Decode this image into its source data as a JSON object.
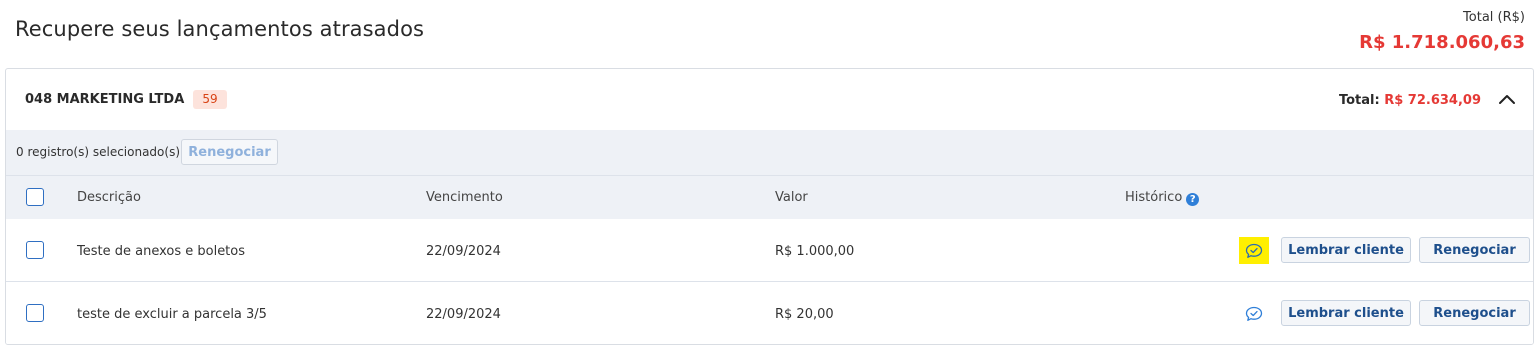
{
  "page": {
    "title": "Recupere seus lançamentos atrasados",
    "total_label": "Total (R$)",
    "total_value": "R$ 1.718.060,63"
  },
  "group": {
    "company": "048 MARKETING LTDA",
    "count": "59",
    "total_label": "Total:",
    "total_value": "R$ 72.634,09",
    "selection_text": "0 registro(s) selecionado(s)",
    "renegotiate_bulk_label": "Renegociar",
    "columns": {
      "description": "Descrição",
      "due": "Vencimento",
      "value": "Valor",
      "history": "Histórico",
      "help_glyph": "?"
    },
    "rows": [
      {
        "description": "Teste de anexos e boletos",
        "due": "22/09/2024",
        "value": "R$ 1.000,00",
        "remind_label": "Lembrar cliente",
        "renegotiate_label": "Renegociar",
        "history_icon": "chat-check-icon",
        "highlighted": true
      },
      {
        "description": "teste de excluir a parcela 3/5",
        "due": "22/09/2024",
        "value": "R$ 20,00",
        "remind_label": "Lembrar cliente",
        "renegotiate_label": "Renegociar",
        "history_icon": "chat-check-icon",
        "highlighted": false
      }
    ]
  },
  "colors": {
    "accent_red": "#e53935",
    "primary_blue": "#1e4f8c",
    "highlight_yellow": "#ffef00"
  }
}
